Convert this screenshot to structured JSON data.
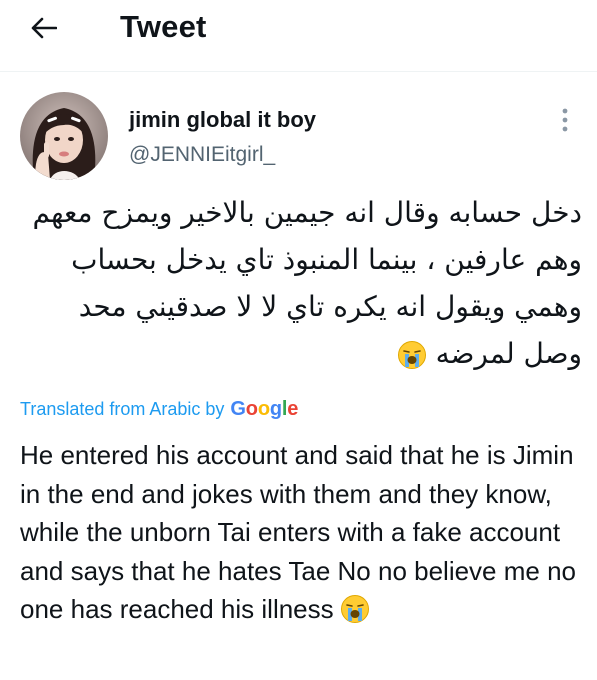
{
  "header": {
    "title": "Tweet",
    "back_icon": "arrow-left-icon"
  },
  "author": {
    "display_name": "jimin global it boy",
    "handle": "@JENNIEitgirl_",
    "avatar_icon": "avatar-photo",
    "more_icon": "more-vertical-icon"
  },
  "tweet": {
    "original_text": "دخل حسابه وقال انه جيمين بالاخير ويمزح معهم وهم عارفين ، بينما المنبوذ تاي يدخل بحساب وهمي ويقول انه يكره تاي لا لا صدقيني محد وصل لمرضه",
    "original_emoji": "loudly-crying-face-icon",
    "translation_label": "Translated from Arabic by",
    "translation_provider": "Google",
    "translated_text": "He entered his account and said that he is Jimin in the end and jokes with them and they know, while the unborn Tai enters with a fake account and says that he hates Tae No no believe me no one has reached his illness",
    "translated_emoji": "loudly-crying-face-icon"
  },
  "colors": {
    "link_blue": "#1d9bf0",
    "secondary_text": "#536471",
    "primary_text": "#0f1419",
    "divider": "#eff3f4"
  }
}
